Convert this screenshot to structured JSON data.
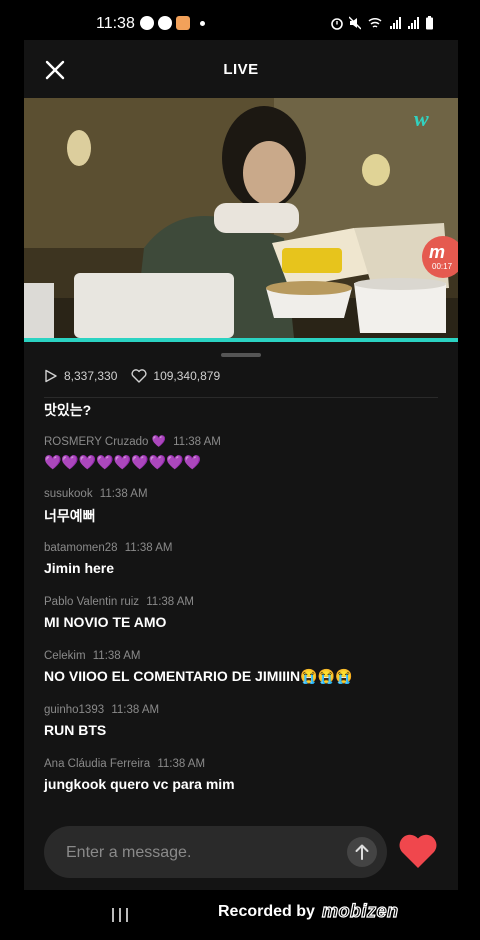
{
  "status_bar": {
    "time": "11:38",
    "left_icons": [
      "app-m-icon",
      "whatsapp-icon",
      "app-orange-icon"
    ],
    "right_icons": [
      "alarm-icon",
      "mute-icon",
      "wifi-icon",
      "signal-icon",
      "signal-icon",
      "battery-icon"
    ]
  },
  "header": {
    "title": "LIVE"
  },
  "video": {
    "brand_icon": "weverse-logo-icon",
    "overlay_time": "00:17",
    "progress": 1.0
  },
  "stats": {
    "plays": "8,337,330",
    "likes": "109,340,879"
  },
  "chat": {
    "partial": {
      "text": "맛있는?"
    },
    "messages": [
      {
        "user": "ROSMERY Cruzado 💜",
        "time": "11:38 AM",
        "text": "💜💜💜💜💜💜💜💜💜"
      },
      {
        "user": "susukook",
        "time": "11:38 AM",
        "text": "너무예뻐"
      },
      {
        "user": "batamomen28",
        "time": "11:38 AM",
        "text": "Jimin here"
      },
      {
        "user": "Pablo Valentin ruiz",
        "time": "11:38 AM",
        "text": "MI NOVIO TE AMO"
      },
      {
        "user": "Celekim",
        "time": "11:38 AM",
        "text": "NO VIIOO EL COMENTARIO DE JIMIIIN😭😭😭"
      },
      {
        "user": "guinho1393",
        "time": "11:38 AM",
        "text": "RUN BTS"
      },
      {
        "user": "Ana Cláudia Ferreira",
        "time": "11:38 AM",
        "text": "jungkook quero vc para mim"
      }
    ]
  },
  "composer": {
    "placeholder": "Enter a message.",
    "value": ""
  },
  "footer": {
    "recorded_by": "Recorded by",
    "brand": "mobizen"
  }
}
